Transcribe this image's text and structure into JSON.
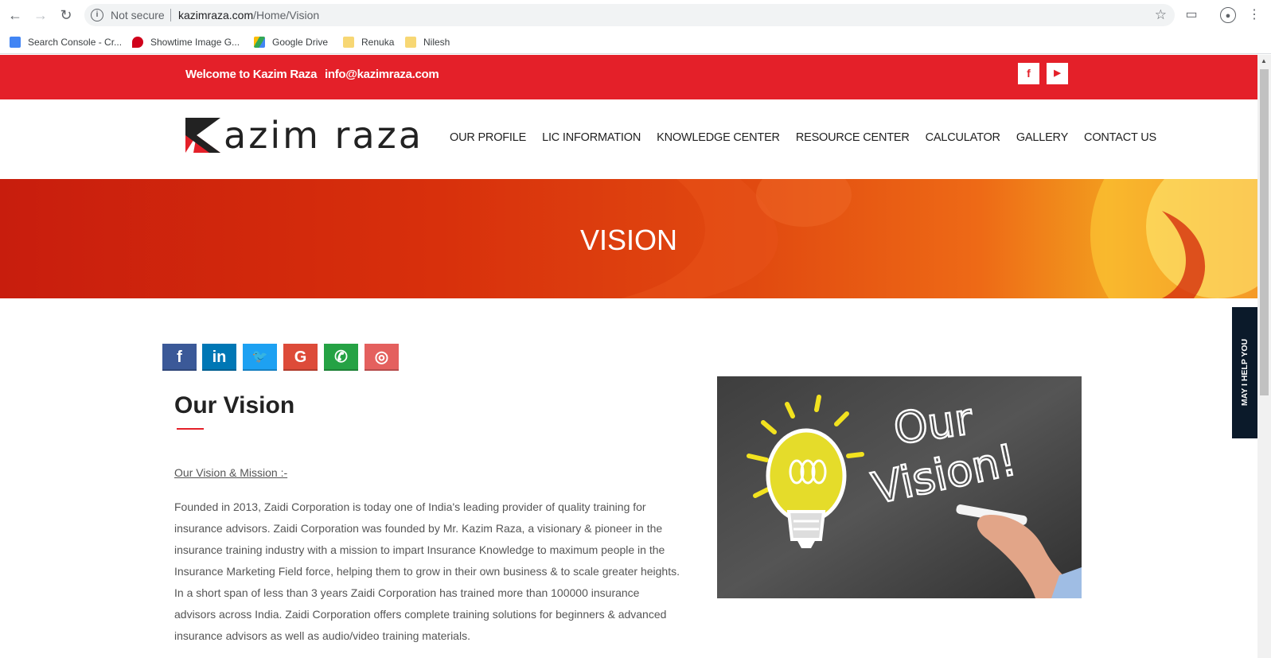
{
  "browser": {
    "security_label": "Not secure",
    "url_domain": "kazimraza.com",
    "url_path": "/Home/Vision",
    "bookmarks": [
      {
        "label": "Search Console - Cr...",
        "color": "#4285f4"
      },
      {
        "label": "Showtime Image G...",
        "color": "#d0021b"
      },
      {
        "label": "Google Drive",
        "color": "#34a853"
      },
      {
        "label": "Renuka",
        "color": "#f7d774"
      },
      {
        "label": "Nilesh",
        "color": "#f7d774"
      }
    ]
  },
  "topbar": {
    "welcome": "Welcome to Kazim Raza",
    "email": "info@kazimraza.com",
    "facebook_glyph": "f",
    "youtube_glyph": "▶",
    "bg_color": "#e42029"
  },
  "header": {
    "logo_text": "azim raza",
    "menu": [
      "OUR PROFILE",
      "LIC INFORMATION",
      "KNOWLEDGE CENTER",
      "RESOURCE CENTER",
      "CALCULATOR",
      "GALLERY",
      "CONTACT US"
    ]
  },
  "banner": {
    "title": "VISION"
  },
  "share": {
    "buttons": [
      {
        "name": "facebook",
        "glyph": "f",
        "color": "#3b5998"
      },
      {
        "name": "linkedin",
        "glyph": "in",
        "color": "#0077b5"
      },
      {
        "name": "twitter",
        "glyph": "🐦",
        "color": "#1da1f2"
      },
      {
        "name": "google",
        "glyph": "G",
        "color": "#dd4b39"
      },
      {
        "name": "whatsapp",
        "glyph": "✆",
        "color": "#25a244"
      },
      {
        "name": "instagram",
        "glyph": "◎",
        "color": "#e4605e"
      }
    ]
  },
  "content": {
    "heading": "Our Vision",
    "mission_link": "Our Vision & Mission :-",
    "paragraph": "Founded in 2013, Zaidi Corporation is today one of India's leading provider of quality training for insurance advisors. Zaidi Corporation was founded by Mr. Kazim Raza, a visionary & pioneer in the insurance training industry with a mission to impart Insurance Knowledge to maximum people in the Insurance Marketing Field force, helping them to grow in their own business & to scale greater heights. In a short span of less than 3 years Zaidi Corporation has trained more than 100000 insurance advisors across India. Zaidi Corporation offers complete training solutions for beginners & advanced insurance advisors as well as audio/video training materials."
  },
  "image": {
    "chalk_text_line1": "Our",
    "chalk_text_line2": "Vision!"
  },
  "help_tab": {
    "label": "MAY I HELP YOU"
  }
}
